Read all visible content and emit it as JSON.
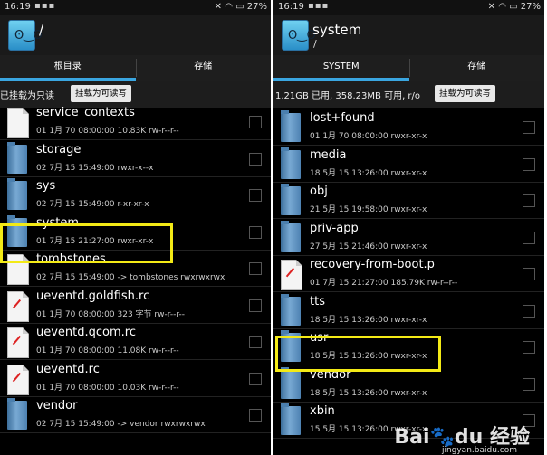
{
  "left": {
    "status": {
      "time": "16:19",
      "battery": "27%"
    },
    "header": {
      "title": "/",
      "subtitle": ""
    },
    "tabs": [
      "根目录",
      "存储"
    ],
    "info": "已挂载为只读",
    "mount_button": "挂载为可读写",
    "items": [
      {
        "name": "service_contexts",
        "meta": "01 1月 70 08:00:00   10.83K   rw-r--r--",
        "type": "file",
        "red": false
      },
      {
        "name": "storage",
        "meta": "02 7月 15 15:49:00   rwxr-x--x",
        "type": "folder",
        "red": false
      },
      {
        "name": "sys",
        "meta": "02 7月 15 15:49:00   r-xr-xr-x",
        "type": "folder",
        "red": false
      },
      {
        "name": "system",
        "meta": "01 7月 15 21:27:00   rwxr-xr-x",
        "type": "folder",
        "red": false
      },
      {
        "name": "tombstones",
        "meta": "02 7月 15 15:49:00  -> tombstones  rwxrwxrwx",
        "type": "file",
        "red": false
      },
      {
        "name": "ueventd.goldfish.rc",
        "meta": "01 1月 70 08:00:00   323 字节   rw-r--r--",
        "type": "file",
        "red": true
      },
      {
        "name": "ueventd.qcom.rc",
        "meta": "01 1月 70 08:00:00   11.08K   rw-r--r--",
        "type": "file",
        "red": true
      },
      {
        "name": "ueventd.rc",
        "meta": "01 1月 70 08:00:00   10.03K   rw-r--r--",
        "type": "file",
        "red": true
      },
      {
        "name": "vendor",
        "meta": "02 7月 15 15:49:00  -> vendor  rwxrwxrwx",
        "type": "folder",
        "red": false
      }
    ]
  },
  "right": {
    "status": {
      "time": "16:19",
      "battery": "27%"
    },
    "header": {
      "title": "system",
      "subtitle": "/"
    },
    "tabs": [
      "SYSTEM",
      "存储"
    ],
    "info": "1.21GB 已用, 358.23MB 可用, r/o",
    "mount_button": "挂载为可读写",
    "items": [
      {
        "name": "lost+found",
        "meta": "01 1月 70 08:00:00   rwxr-xr-x",
        "type": "folder",
        "red": false
      },
      {
        "name": "media",
        "meta": "18 5月 15 13:26:00   rwxr-xr-x",
        "type": "folder",
        "red": false
      },
      {
        "name": "obj",
        "meta": "21 5月 15 19:58:00   rwxr-xr-x",
        "type": "folder",
        "red": false
      },
      {
        "name": "priv-app",
        "meta": "27 5月 15 21:46:00   rwxr-xr-x",
        "type": "folder",
        "red": false
      },
      {
        "name": "recovery-from-boot.p",
        "meta": "01 7月 15 21:27:00   185.79K   rw-r--r--",
        "type": "file",
        "red": true
      },
      {
        "name": "tts",
        "meta": "18 5月 15 13:26:00   rwxr-xr-x",
        "type": "folder",
        "red": false
      },
      {
        "name": "usr",
        "meta": "18 5月 15 13:26:00   rwxr-xr-x",
        "type": "folder",
        "red": false
      },
      {
        "name": "vendor",
        "meta": "18 5月 15 13:26:00   rwxr-xr-x",
        "type": "folder",
        "red": false
      },
      {
        "name": "xbin",
        "meta": "15 5月 15 13:26:00   rwxr-xr-x",
        "type": "folder",
        "red": false
      }
    ]
  },
  "watermark": {
    "text": "Baidu经验",
    "sub": "jingyan.baidu.com"
  }
}
